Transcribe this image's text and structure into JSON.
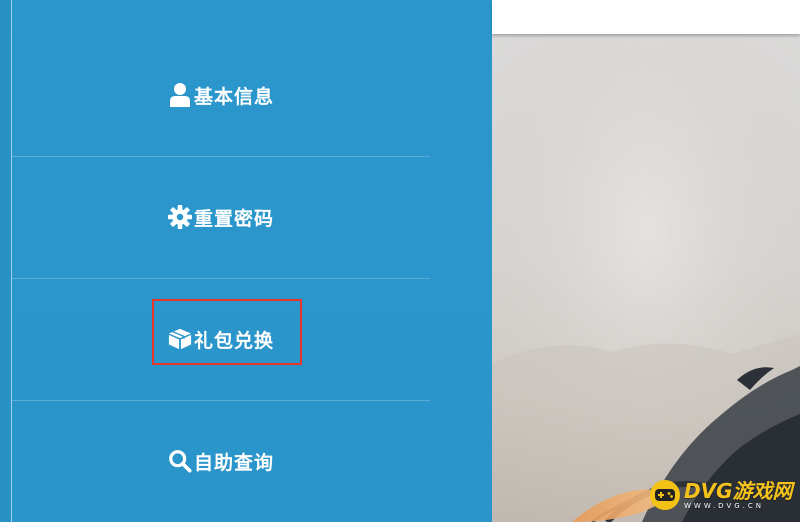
{
  "menu": {
    "items": [
      {
        "label": "基本信息",
        "icon": "user-icon"
      },
      {
        "label": "重置密码",
        "icon": "gear-icon"
      },
      {
        "label": "礼包兑换",
        "icon": "gift-box-icon"
      },
      {
        "label": "自助查询",
        "icon": "search-icon"
      }
    ],
    "highlighted_item": "礼包兑换"
  },
  "watermark": {
    "title": "DVG游戏网",
    "subtitle": "WWW.DVG.CN"
  },
  "colors": {
    "sidebar": "#2a96cc",
    "highlight_border": "#e8352c",
    "watermark": "#f4c21a"
  }
}
